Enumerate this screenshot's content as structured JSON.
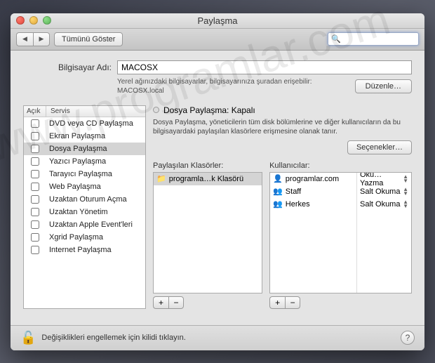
{
  "window": {
    "title": "Paylaşma"
  },
  "toolbar": {
    "show_all": "Tümünü Göster",
    "search_placeholder": ""
  },
  "computer": {
    "label": "Bilgisayar Adı:",
    "value": "MACOSX",
    "subtext": "Yerel ağınızdaki bilgisayarlar, bilgisayarınıza şuradan erişebilir: MACOSX.local",
    "edit_btn": "Düzenle…"
  },
  "services": {
    "header_on": "Açık",
    "header_name": "Servis",
    "items": [
      {
        "on": false,
        "name": "DVD veya CD Paylaşma",
        "selected": false
      },
      {
        "on": false,
        "name": "Ekran Paylaşma",
        "selected": false
      },
      {
        "on": false,
        "name": "Dosya Paylaşma",
        "selected": true
      },
      {
        "on": false,
        "name": "Yazıcı Paylaşma",
        "selected": false
      },
      {
        "on": false,
        "name": "Tarayıcı Paylaşma",
        "selected": false
      },
      {
        "on": false,
        "name": "Web Paylaşma",
        "selected": false
      },
      {
        "on": false,
        "name": "Uzaktan Oturum Açma",
        "selected": false
      },
      {
        "on": false,
        "name": "Uzaktan Yönetim",
        "selected": false
      },
      {
        "on": false,
        "name": "Uzaktan Apple Event'leri",
        "selected": false
      },
      {
        "on": false,
        "name": "Xgrid Paylaşma",
        "selected": false
      },
      {
        "on": false,
        "name": "Internet Paylaşma",
        "selected": false
      }
    ]
  },
  "detail": {
    "status_label": "Dosya Paylaşma: Kapalı",
    "description": "Dosya Paylaşma, yöneticilerin tüm disk bölümlerine ve diğer kullanıcıların da bu bilgisayardaki paylaşılan klasörlere erişmesine olanak tanır.",
    "options_btn": "Seçenekler…",
    "folders_label": "Paylaşılan Klasörler:",
    "users_label": "Kullanıcılar:",
    "folders": [
      {
        "name": "programla…k Klasörü",
        "selected": true
      }
    ],
    "users": [
      {
        "name": "programlar.com",
        "perm": "Oku…Yazma",
        "icon": "single"
      },
      {
        "name": "Staff",
        "perm": "Salt Okuma",
        "icon": "group"
      },
      {
        "name": "Herkes",
        "perm": "Salt Okuma",
        "icon": "group"
      }
    ]
  },
  "footer": {
    "lock_text": "Değişiklikleri engellemek için kilidi tıklayın."
  }
}
